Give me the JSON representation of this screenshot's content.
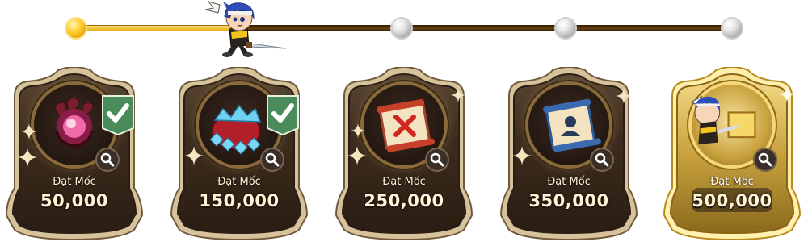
{
  "progress": {
    "reached_nodes": 1,
    "fill_fraction": 0.26
  },
  "milestones": [
    {
      "caption": "Đạt Mốc",
      "value": "50,000",
      "reward_icon": "pink-orb-in-claw-icon",
      "claimed": true,
      "highlight": false
    },
    {
      "caption": "Đạt Mốc",
      "value": "150,000",
      "reward_icon": "diamond-sack-icon",
      "claimed": true,
      "highlight": false
    },
    {
      "caption": "Đạt Mốc",
      "value": "250,000",
      "reward_icon": "red-x-scroll-icon",
      "claimed": false,
      "highlight": false
    },
    {
      "caption": "Đạt Mốc",
      "value": "350,000",
      "reward_icon": "blue-portrait-scroll-icon",
      "claimed": false,
      "highlight": false
    },
    {
      "caption": "Đạt Mốc",
      "value": "500,000",
      "reward_icon": "hero-character-icon",
      "claimed": false,
      "highlight": true
    }
  ],
  "colors": {
    "card_dark": "#3b2a1c",
    "card_border": "#c9b58e",
    "card_gold": "#d9b24a",
    "check_green": "#4a8b5c",
    "track_gold": "#f3c21b",
    "track_dark": "#5e3b0f"
  }
}
